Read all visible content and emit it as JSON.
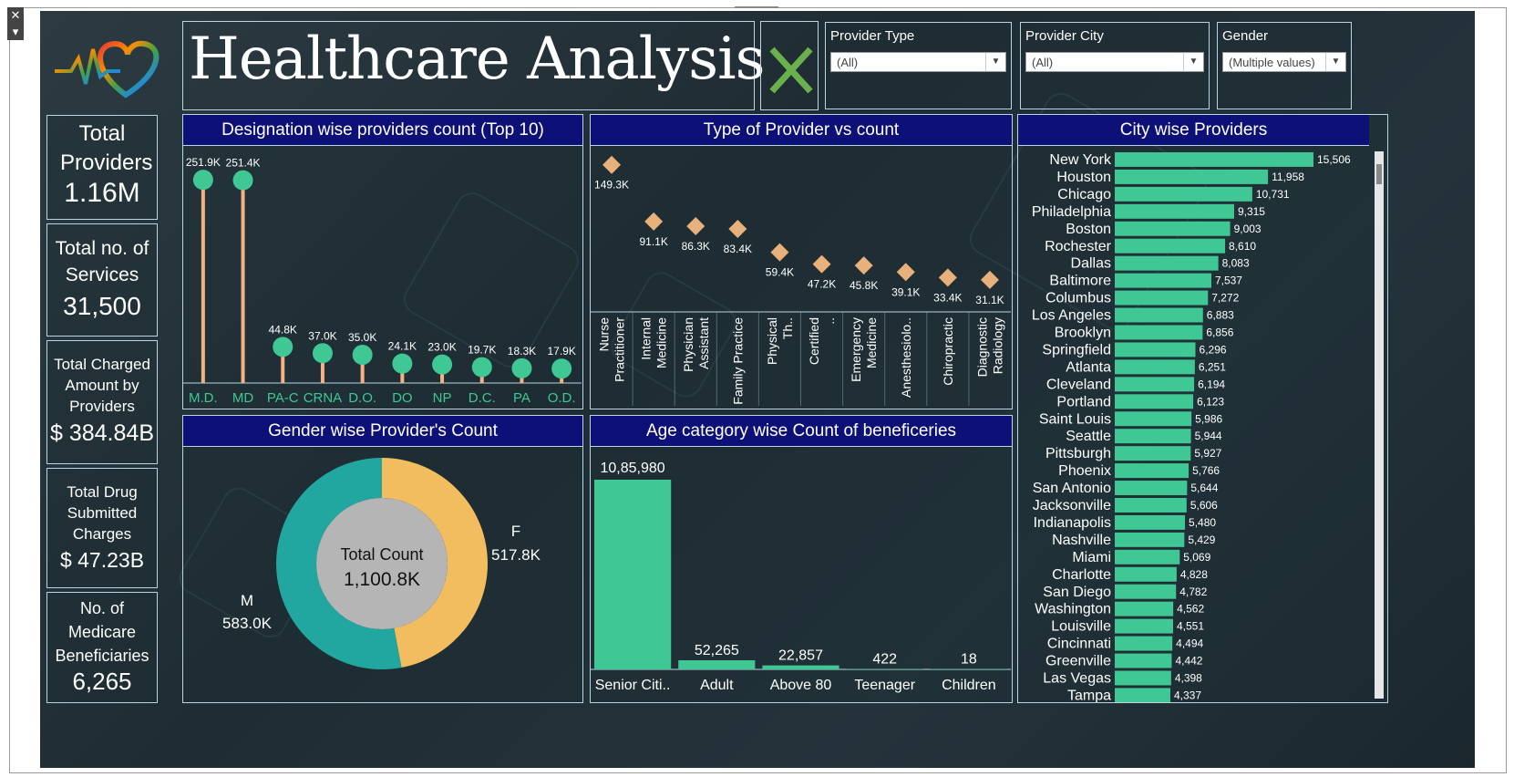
{
  "window": {
    "close_glyph": "✕",
    "menu_glyph": "▾"
  },
  "header": {
    "title": "Healthcare Analysis",
    "logo_icon": "heartbeat-heart-icon",
    "clear_icon": "green-x-icon"
  },
  "filters": [
    {
      "label": "Provider Type",
      "value": "(All)"
    },
    {
      "label": "Provider City",
      "value": "(All)"
    },
    {
      "label": "Gender",
      "value": "(Multiple values)"
    }
  ],
  "kpis": [
    {
      "label": "Total Providers",
      "value": "1.16M"
    },
    {
      "label": "Total no. of Services",
      "value": "31,500"
    },
    {
      "label": "Total Charged Amount by Providers",
      "value": "$ 384.84B"
    },
    {
      "label": "Total Drug Submitted Charges",
      "value": "$ 47.23B"
    },
    {
      "label": "No. of Medicare Beneficiaries",
      "value": "6,265"
    }
  ],
  "colors": {
    "accent_green": "#3fc794",
    "lollipop": "#f4b183",
    "diamond": "#e8b07a",
    "female": "#f2bd5e",
    "male": "#22a7a0",
    "title_bar": "#0d1177",
    "center": "#b5b5b5"
  },
  "chart_data": [
    {
      "type": "lollipop",
      "title": "Designation wise providers count (Top 10)",
      "categories": [
        "M.D.",
        "MD",
        "PA-C",
        "CRNA",
        "D.O.",
        "DO",
        "NP",
        "D.C.",
        "PA",
        "O.D."
      ],
      "values": [
        251900,
        251400,
        44800,
        37000,
        35000,
        24100,
        23000,
        19700,
        18300,
        17900
      ],
      "labels": [
        "251.9K",
        "251.4K",
        "44.8K",
        "37.0K",
        "35.0K",
        "24.1K",
        "23.0K",
        "19.7K",
        "18.3K",
        "17.9K"
      ]
    },
    {
      "type": "scatter",
      "title": "Type of Provider vs count",
      "categories": [
        "Nurse Practitioner",
        "Internal Medicine",
        "Physician Assistant",
        "Family Practice",
        "Physical Th..",
        "Certified ..",
        "Emergency Medicine",
        "Anesthesiolo..",
        "Chiropractic",
        "Diagnostic Radiology"
      ],
      "values": [
        149300,
        91100,
        86300,
        83400,
        59400,
        47200,
        45800,
        39100,
        33400,
        31100
      ],
      "labels": [
        "149.3K",
        "91.1K",
        "86.3K",
        "83.4K",
        "59.4K",
        "47.2K",
        "45.8K",
        "39.1K",
        "33.4K",
        "31.1K"
      ]
    },
    {
      "type": "bar",
      "title": "City wise Providers",
      "categories": [
        "New York",
        "Houston",
        "Chicago",
        "Philadelphia",
        "Boston",
        "Rochester",
        "Dallas",
        "Baltimore",
        "Columbus",
        "Los Angeles",
        "Brooklyn",
        "Springfield",
        "Atlanta",
        "Cleveland",
        "Portland",
        "Saint Louis",
        "Seattle",
        "Pittsburgh",
        "Phoenix",
        "San Antonio",
        "Jacksonville",
        "Indianapolis",
        "Nashville",
        "Miami",
        "Charlotte",
        "San Diego",
        "Washington",
        "Louisville",
        "Cincinnati",
        "Greenville",
        "Las Vegas",
        "Tampa"
      ],
      "values": [
        15506,
        11958,
        10731,
        9315,
        9003,
        8610,
        8083,
        7537,
        7272,
        6883,
        6856,
        6296,
        6251,
        6194,
        6123,
        5986,
        5944,
        5927,
        5766,
        5644,
        5606,
        5480,
        5429,
        5069,
        4828,
        4782,
        4562,
        4551,
        4494,
        4442,
        4398,
        4337
      ],
      "labels": [
        "15,506",
        "11,958",
        "10,731",
        "9,315",
        "9,003",
        "8,610",
        "8,083",
        "7,537",
        "7,272",
        "6,883",
        "6,856",
        "6,296",
        "6,251",
        "6,194",
        "6,123",
        "5,986",
        "5,944",
        "5,927",
        "5,766",
        "5,644",
        "5,606",
        "5,480",
        "5,429",
        "5,069",
        "4,828",
        "4,782",
        "4,562",
        "4,551",
        "4,494",
        "4,442",
        "4,398",
        "4,337"
      ]
    },
    {
      "type": "pie",
      "title": "Gender wise Provider's Count",
      "center_label": "Total Count",
      "center_value": "1,100.8K",
      "slices": [
        {
          "name": "F",
          "value": 517.8,
          "label": "517.8K"
        },
        {
          "name": "M",
          "value": 583.0,
          "label": "583.0K"
        }
      ]
    },
    {
      "type": "bar",
      "title": "Age category wise Count of beneficeries",
      "categories": [
        "Senior Citi..",
        "Adult",
        "Above 80",
        "Teenager",
        "Children"
      ],
      "values": [
        1085980,
        52265,
        22857,
        422,
        18
      ],
      "labels": [
        "10,85,980",
        "52,265",
        "22,857",
        "422",
        "18"
      ]
    }
  ]
}
